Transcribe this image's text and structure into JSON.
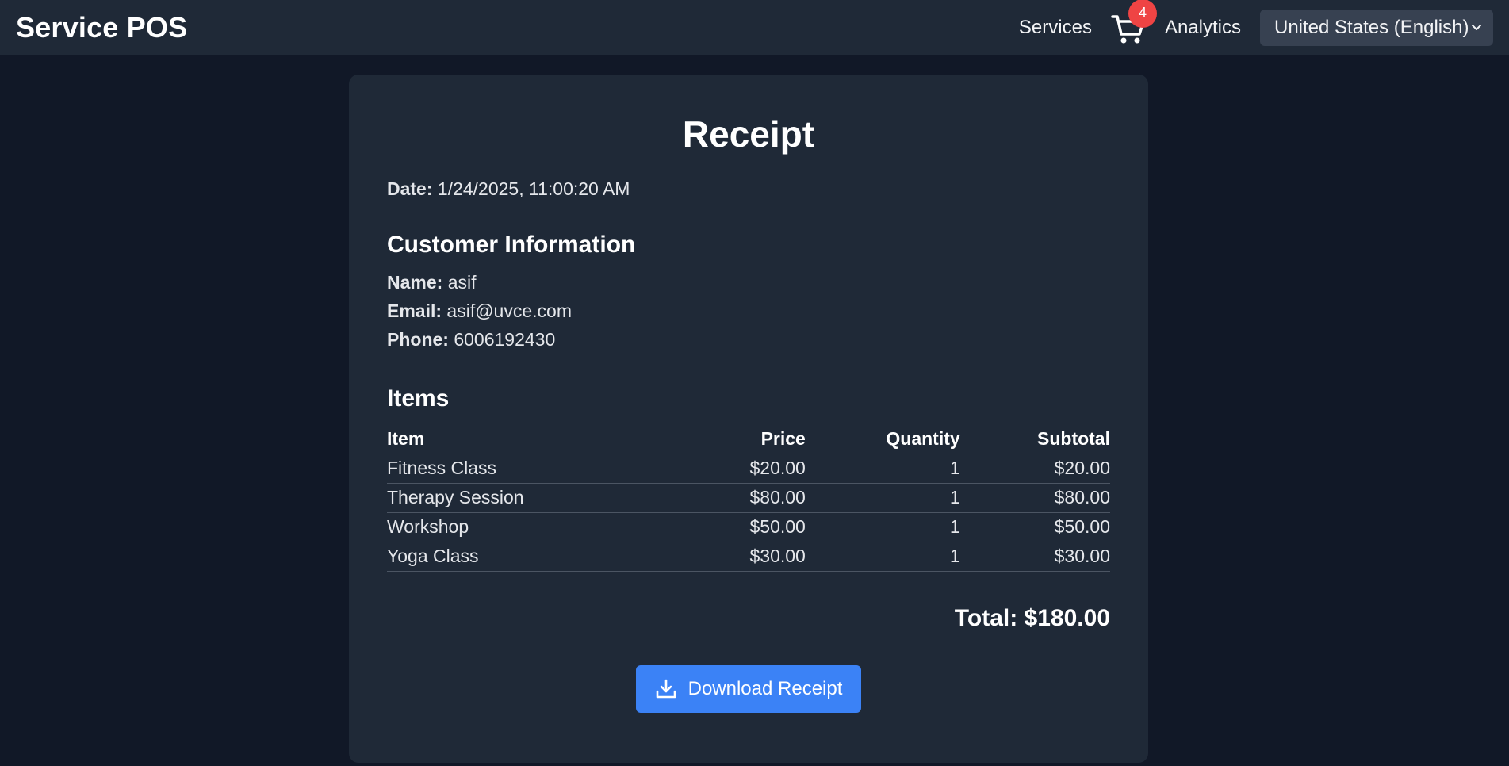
{
  "header": {
    "brand": "Service POS",
    "nav": {
      "services_label": "Services",
      "cart_count": "4",
      "cart_icon": "shopping-cart-icon",
      "analytics_label": "Analytics"
    },
    "language_select": {
      "selected": "United States (English)"
    }
  },
  "receipt": {
    "title": "Receipt",
    "date_label": "Date:",
    "date_value": "1/24/2025, 11:00:20 AM",
    "customer": {
      "heading": "Customer Information",
      "name_label": "Name:",
      "name_value": "asif",
      "email_label": "Email:",
      "email_value": "asif@uvce.com",
      "phone_label": "Phone:",
      "phone_value": "6006192430"
    },
    "items": {
      "heading": "Items",
      "columns": [
        "Item",
        "Price",
        "Quantity",
        "Subtotal"
      ],
      "rows": [
        [
          "Fitness Class",
          "$20.00",
          "1",
          "$20.00"
        ],
        [
          "Therapy Session",
          "$80.00",
          "1",
          "$80.00"
        ],
        [
          "Workshop",
          "$50.00",
          "1",
          "$50.00"
        ],
        [
          "Yoga Class",
          "$30.00",
          "1",
          "$30.00"
        ]
      ]
    },
    "total_text": "Total: $180.00",
    "download_label": "Download Receipt",
    "download_icon": "download-icon"
  },
  "colors": {
    "page_bg": "#111827",
    "card_bg": "#1f2937",
    "accent": "#3b82f6",
    "badge": "#ef4444"
  }
}
